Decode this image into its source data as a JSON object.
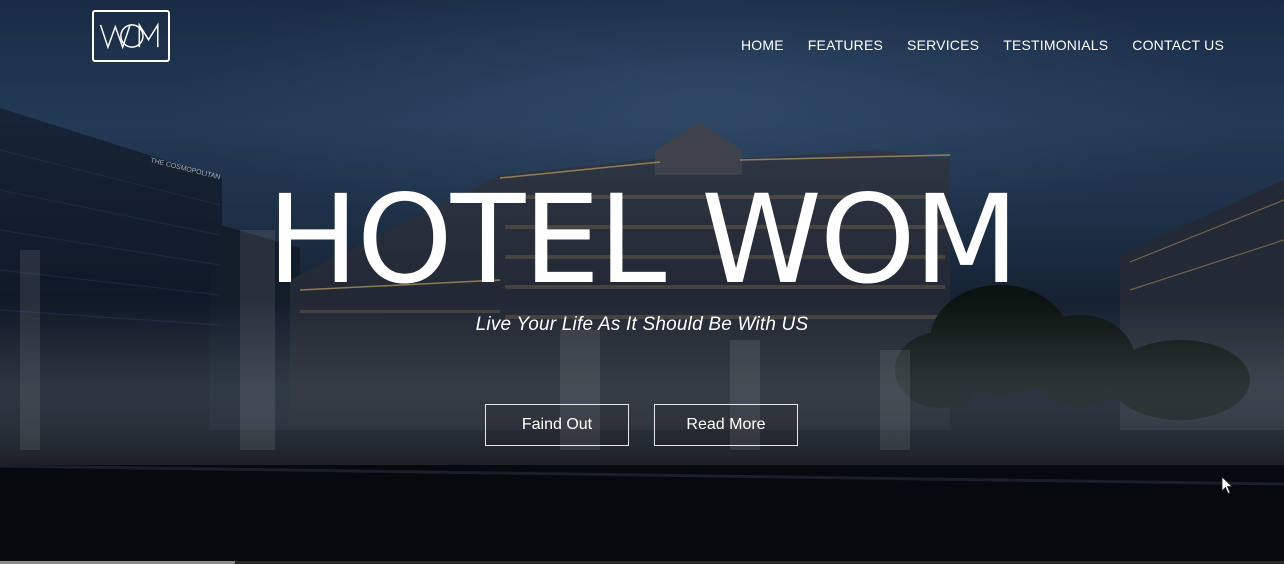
{
  "brand": {
    "logo_text": "WOM"
  },
  "nav": {
    "items": [
      {
        "label": "HOME"
      },
      {
        "label": "FEATURES"
      },
      {
        "label": "SERVICES"
      },
      {
        "label": "TESTIMONIALS"
      },
      {
        "label": "CONTACT US"
      }
    ]
  },
  "hero": {
    "title": "HOTEL WOM",
    "tagline": "Live Your Life As It Should Be With US",
    "buttons": {
      "find_out": "Faind Out",
      "read_more": "Read More"
    },
    "background_sign": "THE COSMOPOLITAN"
  },
  "colors": {
    "text": "#ffffff",
    "sky": "#2a4564",
    "night": "#0a0c12",
    "building_light": "#d8b673"
  }
}
